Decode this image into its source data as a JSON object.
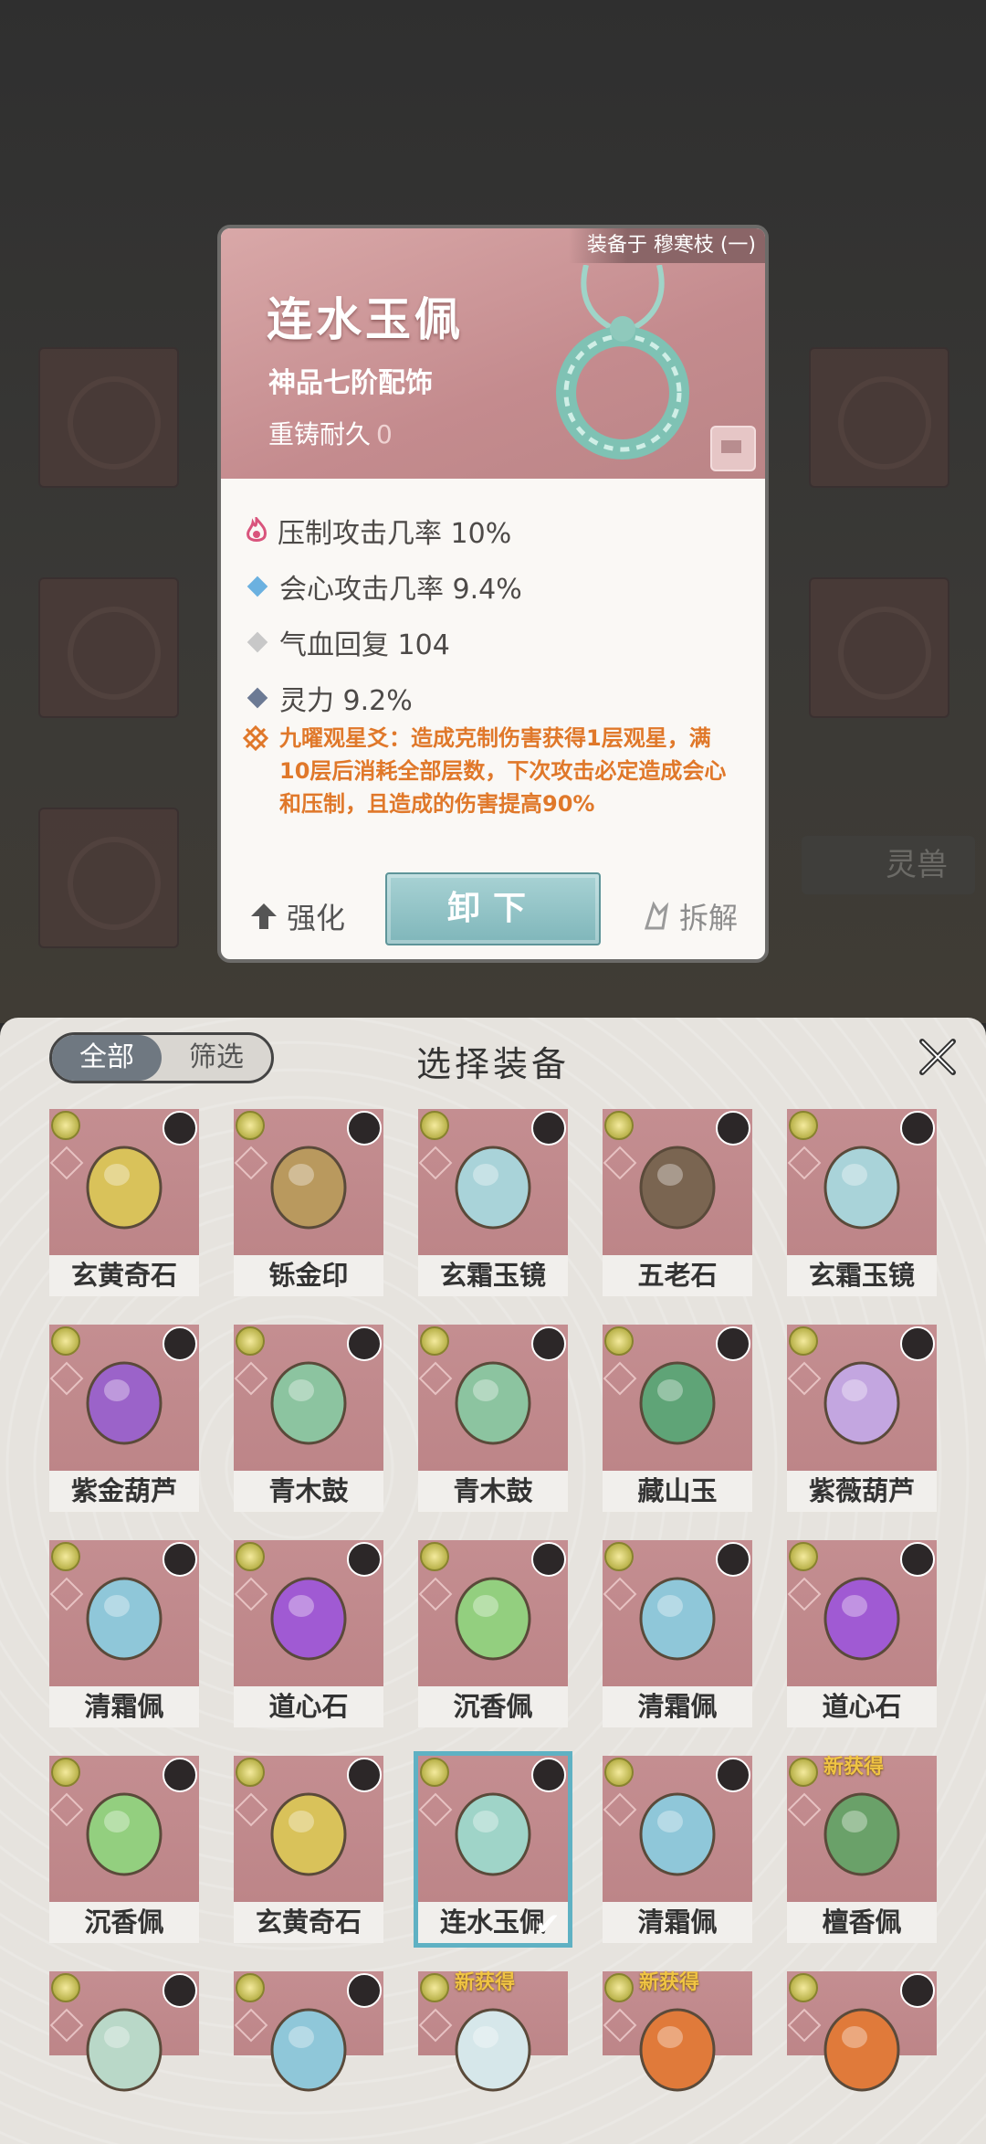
{
  "detail": {
    "equipped_tag": "装备于 穆寒枝 (一)",
    "name": "连水玉佩",
    "grade": "神品七阶配饰",
    "durability_label": "重铸耐久",
    "durability_value": "0",
    "stats": [
      {
        "text": "压制攻击几率 10%",
        "icon": "flame-icon",
        "color": "#d9547c"
      },
      {
        "text": "会心攻击几率 9.4%",
        "icon": "diamond-icon",
        "color": "#6bb1e0"
      },
      {
        "text": "气血回复 104",
        "icon": "diamond-icon",
        "color": "#c8c8c8"
      },
      {
        "text": "灵力 9.2%",
        "icon": "diamond-icon",
        "color": "#6c7a94"
      }
    ],
    "effect": "九曜观星爻：造成克制伤害获得1层观星，满10层后消耗全部层数，下次攻击必定造成会心和压制，且造成的伤害提高90%",
    "strengthen": "强化",
    "unequip": "卸下",
    "dismantle": "拆解"
  },
  "background": {
    "beast_label": "灵兽"
  },
  "panel": {
    "tab_all": "全部",
    "tab_filter": "筛选",
    "title": "选择装备",
    "new_label": "新获得",
    "items": [
      {
        "name": "玄黄奇石",
        "color": "#d9c25a"
      },
      {
        "name": "铄金印",
        "color": "#b9995e"
      },
      {
        "name": "玄霜玉镜",
        "color": "#a9d3d9"
      },
      {
        "name": "五老石",
        "color": "#7a6551"
      },
      {
        "name": "玄霜玉镜",
        "color": "#a9d3d9"
      },
      {
        "name": "紫金葫芦",
        "color": "#9b63c9"
      },
      {
        "name": "青木鼓",
        "color": "#8cc4a0"
      },
      {
        "name": "青木鼓",
        "color": "#8cc4a0"
      },
      {
        "name": "藏山玉",
        "color": "#5fa477"
      },
      {
        "name": "紫薇葫芦",
        "color": "#c3a6e0"
      },
      {
        "name": "清霜佩",
        "color": "#8fc7d9"
      },
      {
        "name": "道心石",
        "color": "#a05ad3"
      },
      {
        "name": "沉香佩",
        "color": "#93cf7f"
      },
      {
        "name": "清霜佩",
        "color": "#8fc7d9"
      },
      {
        "name": "道心石",
        "color": "#a05ad3"
      },
      {
        "name": "沉香佩",
        "color": "#93cf7f"
      },
      {
        "name": "玄黄奇石",
        "color": "#d9c25a"
      },
      {
        "name": "连水玉佩",
        "color": "#9fd4c8",
        "selected": true
      },
      {
        "name": "清霜佩",
        "color": "#8fc7d9"
      },
      {
        "name": "檀香佩",
        "color": "#6aa169",
        "new": true
      },
      {
        "name": "",
        "color": "#b9d8c8"
      },
      {
        "name": "",
        "color": "#8fc7d9"
      },
      {
        "name": "",
        "color": "#d6e7ea",
        "new": true
      },
      {
        "name": "",
        "color": "#e07a3a",
        "new": true
      },
      {
        "name": "",
        "color": "#e07a3a"
      }
    ]
  }
}
